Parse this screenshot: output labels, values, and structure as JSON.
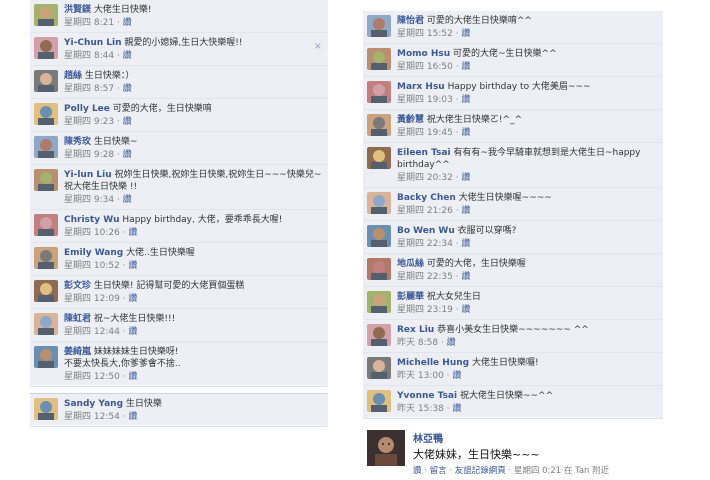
{
  "colors": {
    "link": "#3b5998",
    "comment_bg": "#edeff4",
    "meta": "#808080"
  },
  "left_comments": [
    {
      "author": "洪賢鎂",
      "text": "大佬生日快樂!",
      "time": "星期四 8:21",
      "like": "讚",
      "avatar": "avatar-photo-icon"
    },
    {
      "author": "Yi-Chun Lin",
      "text": "親愛的小媳婦,生日大快樂喔!!",
      "time": "星期四 8:44",
      "like": "讚",
      "avatar": "avatar-photo-icon"
    },
    {
      "author": "趙絲",
      "text": "生日快樂：）",
      "time": "星期四 8:57",
      "like": "讚",
      "avatar": "avatar-photo-icon"
    },
    {
      "author": "Polly Lee",
      "text": "可愛的大佬，生日快樂唷",
      "time": "星期四 9:23",
      "like": "讚",
      "avatar": "avatar-photo-icon"
    },
    {
      "author": "陳秀玫",
      "text": "生日快樂~",
      "time": "星期四 9:28",
      "like": "讚",
      "avatar": "avatar-photo-icon"
    },
    {
      "author": "Yi-lun Liu",
      "text": "祝妳生日快樂,祝妳生日快樂,祝妳生日~~~快樂兒~~~",
      "cont": "祝大佬生日快樂 !!",
      "time": "星期四 9:34",
      "like": "讚",
      "avatar": "avatar-photo-icon"
    },
    {
      "author": "Christy Wu",
      "text": "Happy birthday, 大佬，要乖乖長大喔!",
      "time": "星期四 10:26",
      "like": "讚",
      "avatar": "avatar-photo-icon"
    },
    {
      "author": "Emily Wang",
      "text": "大佬..生日快樂喔",
      "time": "星期四 10:52",
      "like": "讚",
      "avatar": "avatar-photo-icon"
    },
    {
      "author": "彭文珍",
      "text": "生日快樂! 記得幫可愛的大佬買個蛋糕",
      "time": "星期四 12:09",
      "like": "讚",
      "avatar": "avatar-photo-icon"
    },
    {
      "author": "陳虹君",
      "text": "祝~大佬生日快樂!!!",
      "time": "星期四 12:44",
      "like": "讚",
      "avatar": "avatar-photo-icon"
    },
    {
      "author": "姜綺嵐",
      "text": "妹妹妹妹生日快樂呀!",
      "cont": "不要太快長大,你爹爹會不捨..",
      "time": "星期四 12:50",
      "like": "讚",
      "avatar": "avatar-photo-icon"
    }
  ],
  "left_standalone": {
    "author": "Sandy Yang",
    "text": "生日快樂",
    "time": "星期四 12:54",
    "like": "讚",
    "avatar": "avatar-photo-icon"
  },
  "right_comments": [
    {
      "author": "陳怡君",
      "text": "可愛的大佬生日快樂唷^^",
      "time": "星期四 15:52",
      "like": "讚",
      "avatar": "avatar-photo-icon"
    },
    {
      "author": "Momo Hsu",
      "text": "可愛的大佬~生日快樂^^",
      "time": "星期四 16:50",
      "like": "讚",
      "avatar": "avatar-photo-icon"
    },
    {
      "author": "Marx Hsu",
      "text": "Happy birthday to 大佬美眉~~~",
      "time": "星期四 19:03",
      "like": "讚",
      "avatar": "avatar-photo-icon"
    },
    {
      "author": "黃齡慧",
      "text": "祝大佬生日快樂ㄛ!^_^",
      "time": "星期四 19:45",
      "like": "讚",
      "avatar": "avatar-photo-icon"
    },
    {
      "author": "Eileen Tsai",
      "text": "有有有~我今早騎車就想到是大佬生日~happy",
      "cont": "birthday^^",
      "time": "星期四 20:32",
      "like": "讚",
      "avatar": "avatar-photo-icon"
    },
    {
      "author": "Backy Chen",
      "text": "大佬生日快樂喔~~~~",
      "time": "星期四 21:26",
      "like": "讚",
      "avatar": "avatar-photo-icon"
    },
    {
      "author": "Bo Wen Wu",
      "text": "衣服可以穿嗎?",
      "time": "星期四 22:34",
      "like": "讚",
      "avatar": "avatar-photo-icon"
    },
    {
      "author": "地瓜絲",
      "text": "可愛的大佬，生日快樂喔",
      "time": "星期四 22:35",
      "like": "讚",
      "avatar": "avatar-photo-icon"
    },
    {
      "author": "彭麗華",
      "text": "祝大女兒生日",
      "time": "星期四 23:19",
      "like": "讚",
      "avatar": "avatar-photo-icon"
    },
    {
      "author": "Rex Liu",
      "text": "恭喜小美女生日快樂~~~~~~~ ^^",
      "time": "昨天 8:58",
      "like": "讚",
      "avatar": "avatar-photo-icon"
    },
    {
      "author": "Michelle Hung",
      "text": "大佬生日快樂囉!",
      "time": "昨天 13:00",
      "like": "讚",
      "avatar": "avatar-photo-icon"
    },
    {
      "author": "Yvonne Tsai",
      "text": "祝大佬生日快樂~~^^",
      "time": "昨天 15:38",
      "like": "讚",
      "avatar": "avatar-photo-icon"
    }
  ],
  "big_post": {
    "author": "林亞鴨",
    "text": "大佬妹妹，生日快樂~~~",
    "actions": {
      "like": "讚",
      "sep1": " · ",
      "comment": "留言",
      "sep2": " · ",
      "friendship": "友誼記錄網頁",
      "time": " · 星期四 0:21 在 Tan 附近"
    }
  }
}
